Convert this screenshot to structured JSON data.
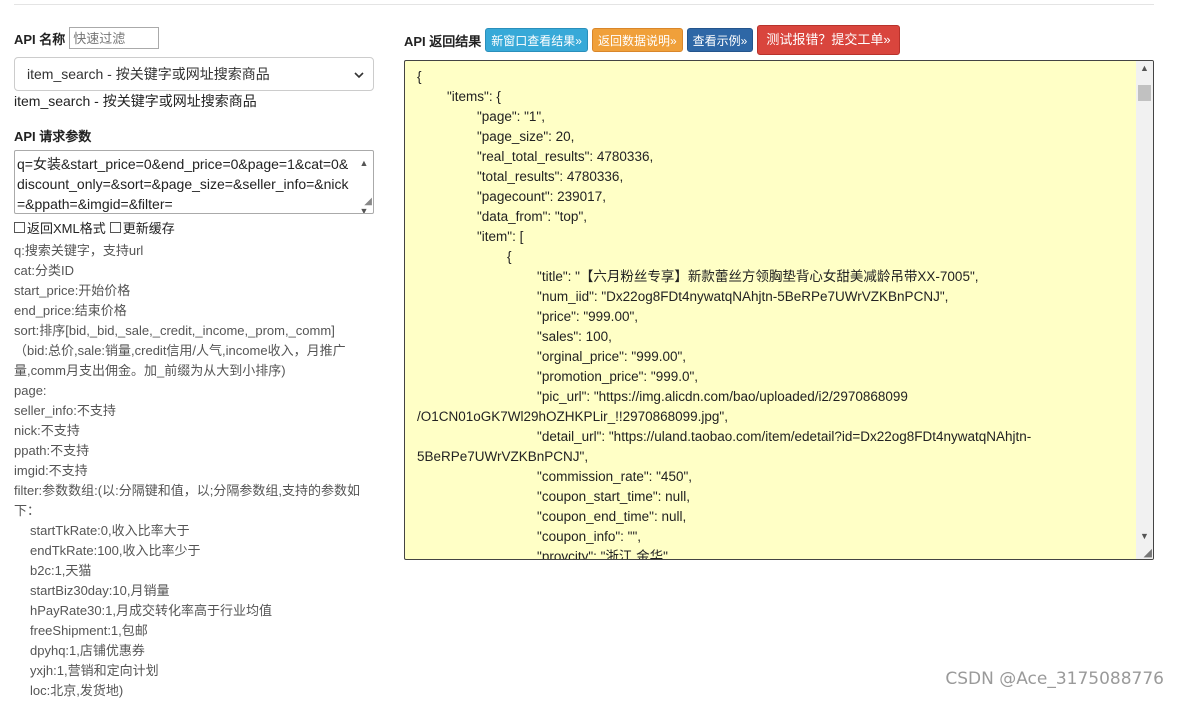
{
  "left": {
    "api_name_label": "API 名称",
    "filter_placeholder": "快速过滤",
    "selected_api": "item_search - 按关键字或网址搜索商品",
    "selected_desc": "item_search - 按关键字或网址搜索商品",
    "params_label": "API 请求参数",
    "params_value": "q=女装&start_price=0&end_price=0&page=1&cat=0&discount_only=&sort=&page_size=&seller_info=&nick=&ppath=&imgid=&filter=",
    "check_xml": "返回XML格式",
    "check_cache": "更新缓存",
    "docs": [
      "q:搜索关键字，支持url",
      "cat:分类ID",
      "start_price:开始价格",
      "end_price:结束价格",
      "sort:排序[bid,_bid,_sale,_credit,_income,_prom,_comm]",
      "（bid:总价,sale:销量,credit信用/人气,income收入，月推广量,comm月支出佣金。加_前缀为从大到小排序)",
      "page:",
      "seller_info:不支持",
      "nick:不支持",
      "ppath:不支持",
      "imgid:不支持",
      "filter:参数数组:(以:分隔键和值，以;分隔参数组,支持的参数如下：",
      "startTkRate:0,收入比率大于",
      "endTkRate:100,收入比率少于",
      "b2c:1,天猫",
      "startBiz30day:10,月销量",
      "hPayRate30:1,月成交转化率高于行业均值",
      "freeShipment:1,包邮",
      "dpyhq:1,店铺优惠券",
      "yxjh:1,营销和定向计划",
      "loc:北京,发货地)"
    ]
  },
  "right": {
    "result_label": "API 返回结果",
    "btn_new_window": "新窗口查看结果»",
    "btn_return_doc": "返回数据说明»",
    "btn_example": "查看示例»",
    "btn_report": "测试报错？提交工单»",
    "code_lines": [
      "{",
      "        \"items\": {",
      "                \"page\": \"1\",",
      "                \"page_size\": 20,",
      "                \"real_total_results\": 4780336,",
      "                \"total_results\": 4780336,",
      "                \"pagecount\": 239017,",
      "                \"data_from\": \"top\",",
      "                \"item\": [",
      "                        {",
      "                                \"title\": \"【六月粉丝专享】新款蕾丝方领胸垫背心女甜美减龄吊带XX-7005\",",
      "                                \"num_iid\": \"Dx22og8FDt4nywatqNAhjtn-5BeRPe7UWrVZKBnPCNJ\",",
      "                                \"price\": \"999.00\",",
      "                                \"sales\": 100,",
      "                                \"orginal_price\": \"999.00\",",
      "                                \"promotion_price\": \"999.0\",",
      "                                \"pic_url\": \"https://img.alicdn.com/bao/uploaded/i2/2970868099",
      "/O1CN01oGK7Wl29hOZHKPLir_!!2970868099.jpg\",",
      "                                \"detail_url\": \"https://uland.taobao.com/item/edetail?id=Dx22og8FDt4nywatqNAhjtn-",
      "5BeRPe7UWrVZKBnPCNJ\",",
      "                                \"commission_rate\": \"450\",",
      "                                \"coupon_start_time\": null,",
      "                                \"coupon_end_time\": null,",
      "                                \"coupon_info\": \"\",",
      "                                \"provcity\": \"浙江 金华\","
    ]
  },
  "watermark": "CSDN @Ace_3175088776"
}
